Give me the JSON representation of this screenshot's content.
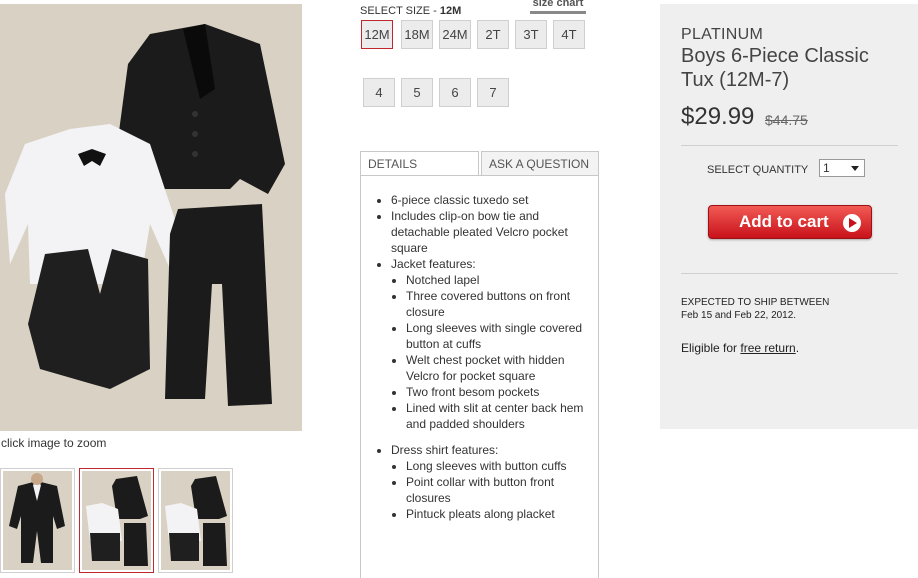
{
  "gallery": {
    "zoom_caption": "click image to zoom",
    "thumbnails": [
      "tux-front-view",
      "tux-pieces-flatlay",
      "tux-pieces-alt"
    ],
    "selected_thumbnail_index": 1
  },
  "size": {
    "label": "SELECT SIZE - ",
    "selected": "12M",
    "chart_link": "size chart",
    "options": [
      "12M",
      "18M",
      "24M",
      "2T",
      "3T",
      "4T",
      "4",
      "5",
      "6",
      "7"
    ]
  },
  "tabs": [
    {
      "label": "DETAILS",
      "active": true
    },
    {
      "label": "ASK A QUESTION",
      "active": false
    }
  ],
  "details": {
    "items": [
      {
        "text": "6-piece classic tuxedo set"
      },
      {
        "text": "Includes clip-on bow tie and detachable pleated Velcro pocket square"
      },
      {
        "text": "Jacket features:",
        "sub": [
          "Notched lapel",
          "Three covered buttons on front closure",
          "Long sleeves with single covered button at cuffs",
          "Welt chest pocket with hidden Velcro for pocket square",
          "Two front besom pockets",
          "Lined with slit at center back hem and padded shoulders"
        ]
      },
      {
        "text": "Dress shirt features:",
        "sub": [
          "Long sleeves with button cuffs",
          "Point collar with button front closures",
          "Pintuck pleats along placket"
        ]
      }
    ]
  },
  "product": {
    "brand": "PLATINUM",
    "title": "Boys 6-Piece Classic Tux (12M-7)",
    "price": "$29.99",
    "old_price": "$44.75",
    "quantity_label": "SELECT QUANTITY",
    "quantity_value": "1",
    "add_to_cart": "Add to cart",
    "ship_line1": "EXPECTED TO SHIP BETWEEN",
    "ship_line2": "Feb 15 and Feb 22, 2012.",
    "eligible_prefix": "Eligible for ",
    "eligible_link": "free return",
    "eligible_suffix": "."
  },
  "colors": {
    "accent_red": "#c0282d",
    "panel_bg": "#efefef",
    "photo_bg": "#d9d2c4"
  }
}
